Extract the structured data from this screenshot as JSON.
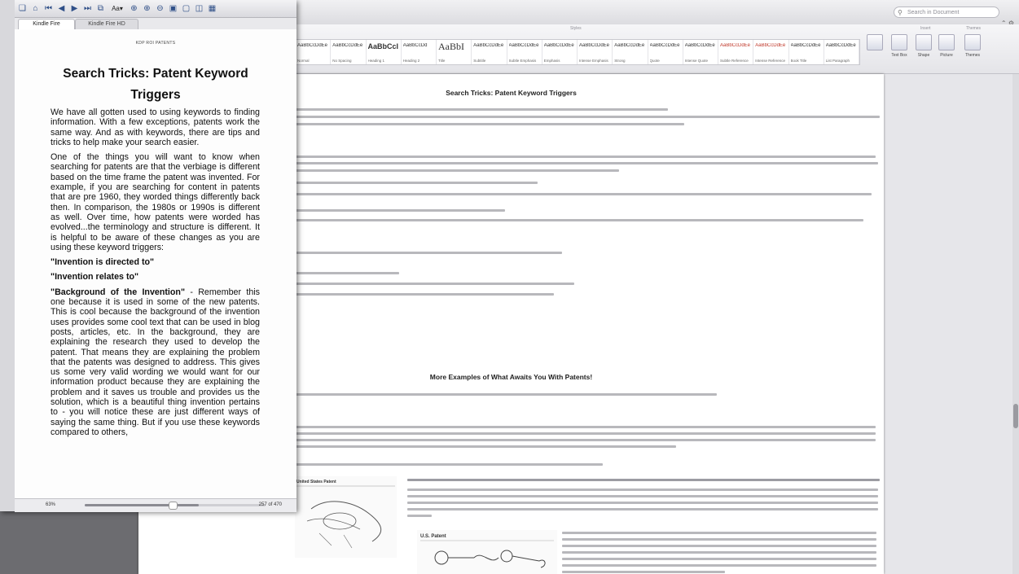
{
  "word": {
    "search_placeholder": "Search in Document",
    "style_group_label": "Styles",
    "insert_group_label": "Insert",
    "themes_group_label": "Themes",
    "styles": [
      {
        "sample": "AaBbCcDdEe",
        "name": "Normal"
      },
      {
        "sample": "AaBbCcDdEe",
        "name": "No Spacing"
      },
      {
        "sample": "AaBbCcI",
        "name": "Heading 1"
      },
      {
        "sample": "AaBbCcDd",
        "name": "Heading 2"
      },
      {
        "sample": "AaBbI",
        "name": "Title"
      },
      {
        "sample": "AaBbCcDdEe",
        "name": "Subtitle"
      },
      {
        "sample": "AaBbCcDdEe",
        "name": "Subtle Emphasis"
      },
      {
        "sample": "AaBbCcDdEe",
        "name": "Emphasis"
      },
      {
        "sample": "AaBbCcDdEe",
        "name": "Intense Emphasis"
      },
      {
        "sample": "AaBbCcDdEe",
        "name": "Strong"
      },
      {
        "sample": "AaBbCcDdEe",
        "name": "Quote"
      },
      {
        "sample": "AaBbCcDdEe",
        "name": "Intense Quote"
      },
      {
        "sample": "AaBbCcDdEe",
        "name": "Subtle Reference"
      },
      {
        "sample": "AaBbCcDdEe",
        "name": "Intense Reference"
      },
      {
        "sample": "AaBbCcDdEe",
        "name": "Book Title"
      },
      {
        "sample": "AaBbCcDdEe",
        "name": "List Paragraph"
      }
    ],
    "buttons": [
      {
        "label": "Text Box"
      },
      {
        "label": "Shape"
      },
      {
        "label": "Picture"
      },
      {
        "label": "Themes"
      }
    ],
    "doc": {
      "heading1": "Search Tricks: Patent Keyword Triggers",
      "heading2": "More Examples of What Awaits You With Patents!",
      "patent_label": "U.S. Patent"
    }
  },
  "kindle": {
    "tabs": [
      "Kindle Fire",
      "Kindle Fire HD"
    ],
    "running_header": "KDP ROI PATENTS",
    "title": "Search Tricks: Patent Keyword Triggers",
    "paragraphs": [
      "We have all gotten used to using keywords to finding information. With a few exceptions, patents work the same way. And as with keywords, there are tips and tricks to help make your search easier.",
      "One of the things you will want to know when searching for patents are that the verbiage is different based on the time frame the patent was invented. For example, if you are searching for content in patents that are pre 1960, they worded things differently back then. In comparison, the 1980s or 1990s is different as well. Over time, how patents were worded has evolved...the terminology and structure is different. It is helpful to be aware of these changes as you are using these keyword triggers:"
    ],
    "trigger1": "\"Invention is directed to\"",
    "trigger2": "\"Invention relates to\"",
    "background_lead": "\"Background of the Invention\"",
    "background_text": " - Remember this one because it is used in some of the new patents. This is cool because the background of the invention uses provides some cool text that can be used in blog posts, articles, etc. In the background, they are explaining the research they used to develop the patent. That means they are explaining the problem that the patents was designed to address. This gives us some very valid wording we would want for our information product because they are explaining the problem and it saves us trouble and provides us the solution, which is a beautiful thing invention pertains to - you will notice these are just different ways of saying the same thing. But if you use these keywords compared to others,",
    "status": {
      "percent_label": "63%",
      "location_label": "257 of 470",
      "progress": 0.63
    }
  }
}
